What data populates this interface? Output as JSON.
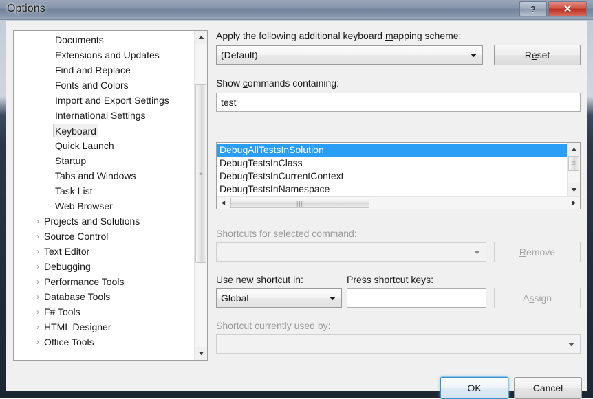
{
  "window": {
    "title": "Options",
    "help_button": "?",
    "close_button": "✕",
    "help_icon_name": "help-icon",
    "close_icon_name": "close-icon"
  },
  "tree": {
    "items": [
      {
        "label": "Documents",
        "type": "leaf",
        "selected": false
      },
      {
        "label": "Extensions and Updates",
        "type": "leaf",
        "selected": false
      },
      {
        "label": "Find and Replace",
        "type": "leaf",
        "selected": false
      },
      {
        "label": "Fonts and Colors",
        "type": "leaf",
        "selected": false
      },
      {
        "label": "Import and Export Settings",
        "type": "leaf",
        "selected": false
      },
      {
        "label": "International Settings",
        "type": "leaf",
        "selected": false
      },
      {
        "label": "Keyboard",
        "type": "leaf",
        "selected": true
      },
      {
        "label": "Quick Launch",
        "type": "leaf",
        "selected": false
      },
      {
        "label": "Startup",
        "type": "leaf",
        "selected": false
      },
      {
        "label": "Tabs and Windows",
        "type": "leaf",
        "selected": false
      },
      {
        "label": "Task List",
        "type": "leaf",
        "selected": false
      },
      {
        "label": "Web Browser",
        "type": "leaf",
        "selected": false
      },
      {
        "label": "Projects and Solutions",
        "type": "parent",
        "selected": false
      },
      {
        "label": "Source Control",
        "type": "parent",
        "selected": false
      },
      {
        "label": "Text Editor",
        "type": "parent",
        "selected": false
      },
      {
        "label": "Debugging",
        "type": "parent",
        "selected": false
      },
      {
        "label": "Performance Tools",
        "type": "parent",
        "selected": false
      },
      {
        "label": "Database Tools",
        "type": "parent",
        "selected": false
      },
      {
        "label": "F# Tools",
        "type": "parent",
        "selected": false
      },
      {
        "label": "HTML Designer",
        "type": "parent",
        "selected": false
      },
      {
        "label": "Office Tools",
        "type": "parent",
        "selected": false
      }
    ],
    "expander_glyph": "›",
    "scrollbar": {
      "up_arrow": "▲",
      "down_arrow": "▼"
    }
  },
  "keyboard_page": {
    "scheme_label_pre": "Apply the following additional keyboard ",
    "scheme_label_accel": "m",
    "scheme_label_post": "apping scheme:",
    "scheme_value": "(Default)",
    "reset_pre": "R",
    "reset_accel": "e",
    "reset_post": "set",
    "filter_label_pre": "Show ",
    "filter_label_accel": "c",
    "filter_label_post": "ommands containing:",
    "filter_value": "test",
    "commands": [
      {
        "label": "DebugAllTestsInSolution",
        "selected": true
      },
      {
        "label": "DebugTestsInClass",
        "selected": false
      },
      {
        "label": "DebugTestsInCurrentContext",
        "selected": false
      },
      {
        "label": "DebugTestsInNamespace",
        "selected": false
      }
    ],
    "shortcuts_label_pre": "Shortc",
    "shortcuts_label_accel": "u",
    "shortcuts_label_post": "ts for selected command:",
    "shortcuts_value": "",
    "remove_pre": "",
    "remove_accel": "R",
    "remove_post": "emove",
    "scope_label_pre": "Use ",
    "scope_label_accel": "n",
    "scope_label_post": "ew shortcut in:",
    "scope_value": "Global",
    "presskeys_label_pre": "",
    "presskeys_label_accel": "P",
    "presskeys_label_post": "ress shortcut keys:",
    "presskeys_value": "",
    "assign_pre": "A",
    "assign_accel": "s",
    "assign_post": "sign",
    "usedby_label_pre": "Shortcut c",
    "usedby_label_accel": "u",
    "usedby_label_post": "rrently used by:",
    "usedby_value": "",
    "combo_arrow": "▼",
    "hscroll_left_arrow": "◀",
    "hscroll_right_arrow": "▶",
    "vscroll_up_arrow": "▲",
    "vscroll_down_arrow": "▼"
  },
  "footer": {
    "ok_label": "OK",
    "cancel_label": "Cancel"
  },
  "colors": {
    "selection_blue": "#2a9ef4",
    "close_red": "#bc2f20",
    "focus_blue": "#3c8ec4"
  }
}
